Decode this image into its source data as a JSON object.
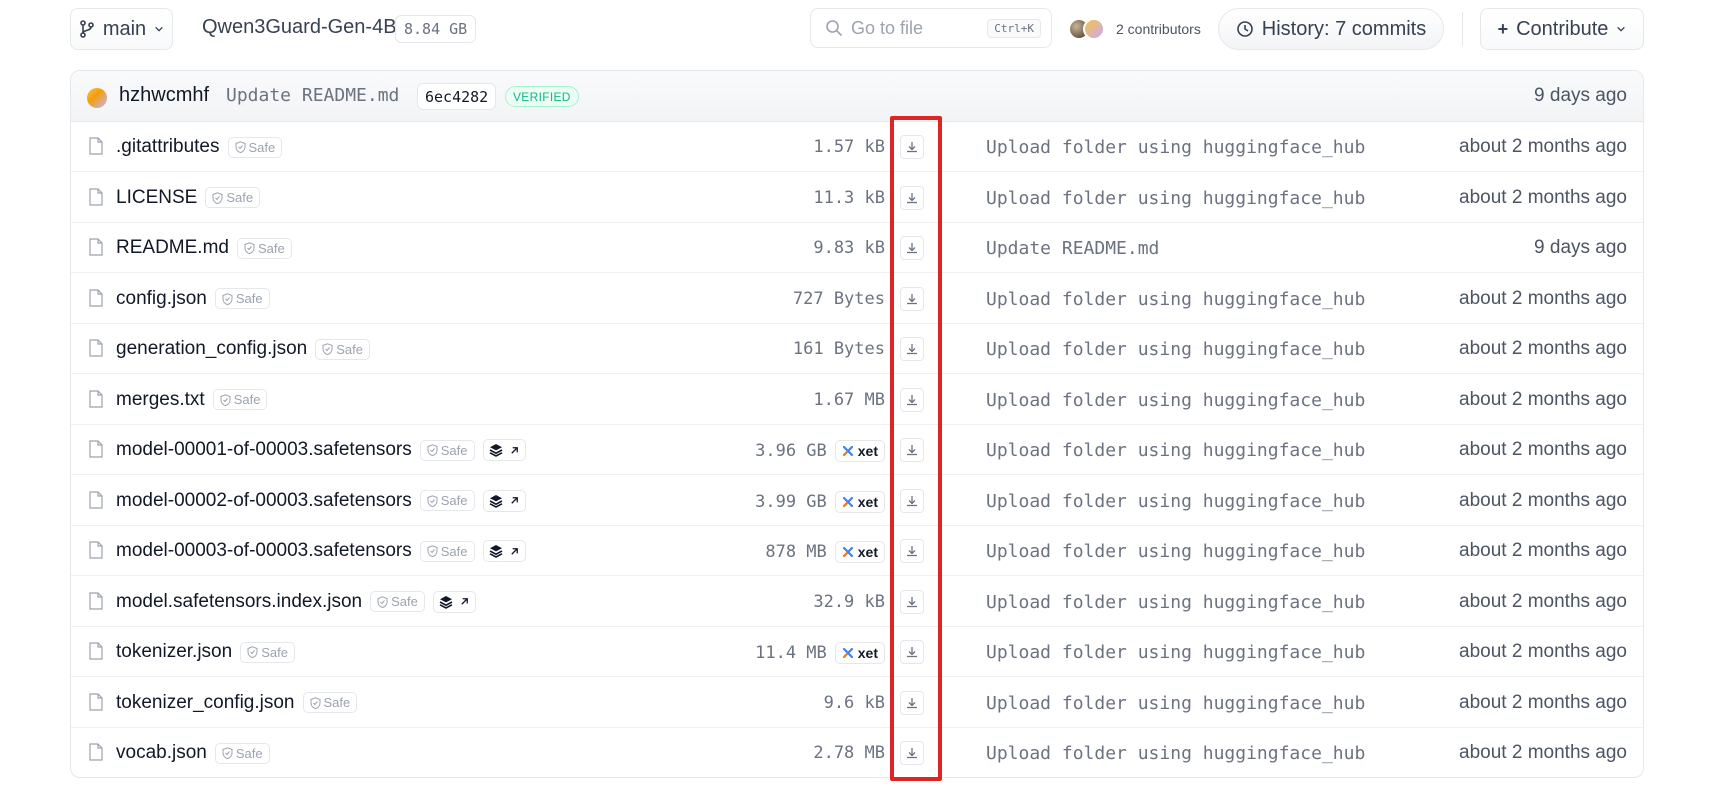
{
  "header": {
    "branch": "main",
    "repo_name": "Qwen3Guard-Gen-4B",
    "repo_size": "8.84 GB",
    "search_placeholder": "Go to file",
    "search_shortcut": "Ctrl+K",
    "contributors_label": "2 contributors",
    "history_label": "History: 7 commits",
    "contribute_label": "Contribute"
  },
  "last_commit": {
    "author": "hzhwcmhf",
    "message": "Update README.md",
    "hash": "6ec4282",
    "verified_label": "VERIFIED",
    "time": "9 days ago"
  },
  "labels": {
    "safe": "Safe",
    "xet": "xet"
  },
  "files": [
    {
      "name": ".gitattributes",
      "size": "1.57 kB",
      "lfs": false,
      "xet": false,
      "message": "Upload folder using huggingface_hub",
      "time": "about 2 months ago"
    },
    {
      "name": "LICENSE",
      "size": "11.3 kB",
      "lfs": false,
      "xet": false,
      "message": "Upload folder using huggingface_hub",
      "time": "about 2 months ago"
    },
    {
      "name": "README.md",
      "size": "9.83 kB",
      "lfs": false,
      "xet": false,
      "message": "Update README.md",
      "time": "9 days ago"
    },
    {
      "name": "config.json",
      "size": "727 Bytes",
      "lfs": false,
      "xet": false,
      "message": "Upload folder using huggingface_hub",
      "time": "about 2 months ago"
    },
    {
      "name": "generation_config.json",
      "size": "161 Bytes",
      "lfs": false,
      "xet": false,
      "message": "Upload folder using huggingface_hub",
      "time": "about 2 months ago"
    },
    {
      "name": "merges.txt",
      "size": "1.67 MB",
      "lfs": false,
      "xet": false,
      "message": "Upload folder using huggingface_hub",
      "time": "about 2 months ago"
    },
    {
      "name": "model-00001-of-00003.safetensors",
      "size": "3.96 GB",
      "lfs": true,
      "xet": true,
      "message": "Upload folder using huggingface_hub",
      "time": "about 2 months ago"
    },
    {
      "name": "model-00002-of-00003.safetensors",
      "size": "3.99 GB",
      "lfs": true,
      "xet": true,
      "message": "Upload folder using huggingface_hub",
      "time": "about 2 months ago"
    },
    {
      "name": "model-00003-of-00003.safetensors",
      "size": "878 MB",
      "lfs": true,
      "xet": true,
      "message": "Upload folder using huggingface_hub",
      "time": "about 2 months ago"
    },
    {
      "name": "model.safetensors.index.json",
      "size": "32.9 kB",
      "lfs": true,
      "xet": false,
      "message": "Upload folder using huggingface_hub",
      "time": "about 2 months ago"
    },
    {
      "name": "tokenizer.json",
      "size": "11.4 MB",
      "lfs": false,
      "xet": true,
      "message": "Upload folder using huggingface_hub",
      "time": "about 2 months ago"
    },
    {
      "name": "tokenizer_config.json",
      "size": "9.6 kB",
      "lfs": false,
      "xet": false,
      "message": "Upload folder using huggingface_hub",
      "time": "about 2 months ago"
    },
    {
      "name": "vocab.json",
      "size": "2.78 MB",
      "lfs": false,
      "xet": false,
      "message": "Upload folder using huggingface_hub",
      "time": "about 2 months ago"
    }
  ],
  "colors": {
    "highlight": "#dc2626",
    "verified": "#10b981",
    "xet_accent_1": "#3b82f6",
    "xet_accent_2": "#f97316"
  }
}
